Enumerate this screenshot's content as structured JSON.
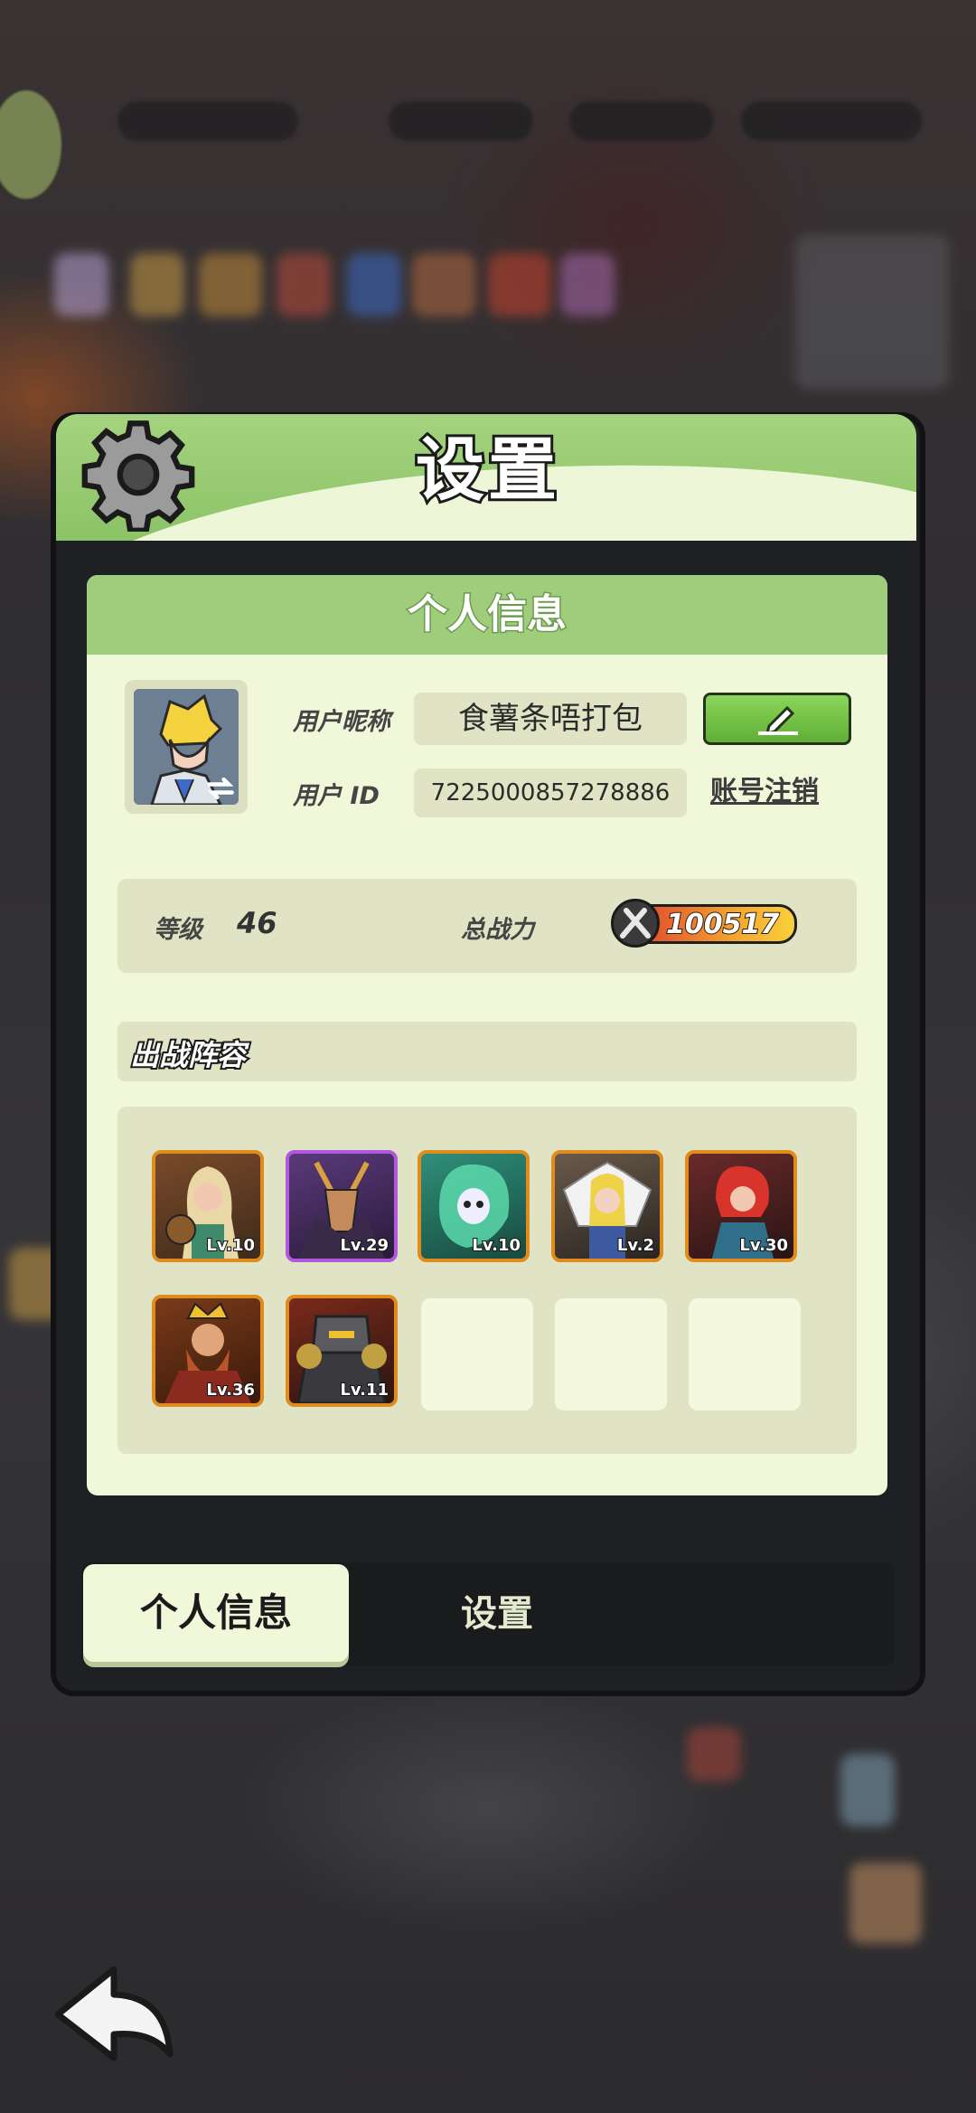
{
  "dialog": {
    "title": "设置",
    "colors": {
      "header_green": "#9fcd7c",
      "panel_bg": "#f1f8d9",
      "field_bg": "#e0e4c4",
      "edit_green": "#6cbe3f",
      "hero_border": "#e08c1c"
    }
  },
  "profile": {
    "section_title": "个人信息",
    "nickname_label": "用户昵称",
    "nickname": "食薯条唔打包",
    "id_label": "用户  ID",
    "user_id": "7225000857278886",
    "edit_icon": "pencil-icon",
    "logout_label": "账号注销",
    "level_label": "等级",
    "level": "46",
    "power_label": "总战力",
    "power": "100517"
  },
  "lineup": {
    "title": "出战阵容",
    "heroes": [
      {
        "level": "Lv.10"
      },
      {
        "level": "Lv.29"
      },
      {
        "level": "Lv.10"
      },
      {
        "level": "Lv.2"
      },
      {
        "level": "Lv.30"
      },
      {
        "level": "Lv.36"
      },
      {
        "level": "Lv.11"
      }
    ],
    "empty_slots": 3
  },
  "tabs": {
    "profile": "个人信息",
    "settings": "设置"
  }
}
